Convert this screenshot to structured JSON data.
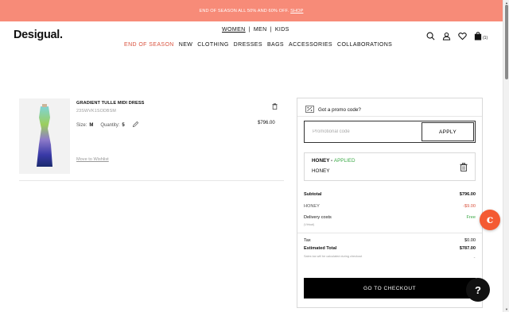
{
  "promo_bar": {
    "text": "END OF SEASON ALL 50% AND 60% OFF.",
    "link": "SHOP"
  },
  "header": {
    "logo": "Desigual.",
    "gender_nav": [
      "WOMEN",
      "|",
      "MEN",
      "|",
      "KIDS"
    ],
    "main_nav": [
      "END OF SEASON",
      "NEW",
      "CLOTHING",
      "DRESSES",
      "BAGS",
      "ACCESSORIES",
      "COLLABORATIONS"
    ],
    "cart_count": "(1)",
    "icons": [
      "search-icon",
      "account-icon",
      "heart-icon",
      "bag-icon"
    ]
  },
  "cart_item": {
    "name": "GRADIENT TULLE MIDI DRESS",
    "ref": "23SWVK1SODBSM",
    "size_label": "Size:",
    "size_value": "M",
    "quantity_label": "Quantity:",
    "quantity_value": "5",
    "price": "$796.00",
    "wishlist_link": "Move to Wishlist"
  },
  "summary": {
    "promo_heading": "Got a promo code?",
    "promo_placeholder": "Promotional code",
    "apply_label": "APPLY",
    "applied_code": "HONEY",
    "applied_sep": " - ",
    "applied_status": "APPLIED",
    "applied_sub": "HONEY",
    "subtotal_label": "Subtotal",
    "subtotal_value": "$796.00",
    "discount_label": "HONEY",
    "discount_value": "-$9.00",
    "delivery_label": "Delivery costs",
    "delivery_value": "Free",
    "delivery_note": "(Virtual)",
    "tax_label": "Tax",
    "tax_value": "$0.00",
    "estimated_label": "Estimated Total",
    "estimated_value": "$787.00",
    "tax_note": "Sales tax will be calculated during checkout",
    "checkout_label": "GO TO CHECKOUT"
  },
  "widgets": {
    "honey_letter": "c",
    "chat_symbol": "?"
  },
  "colors": {
    "promo_bar": "#f78b78",
    "sale": "#d9533f",
    "applied": "#3aa845",
    "honey": "#f45a32"
  }
}
